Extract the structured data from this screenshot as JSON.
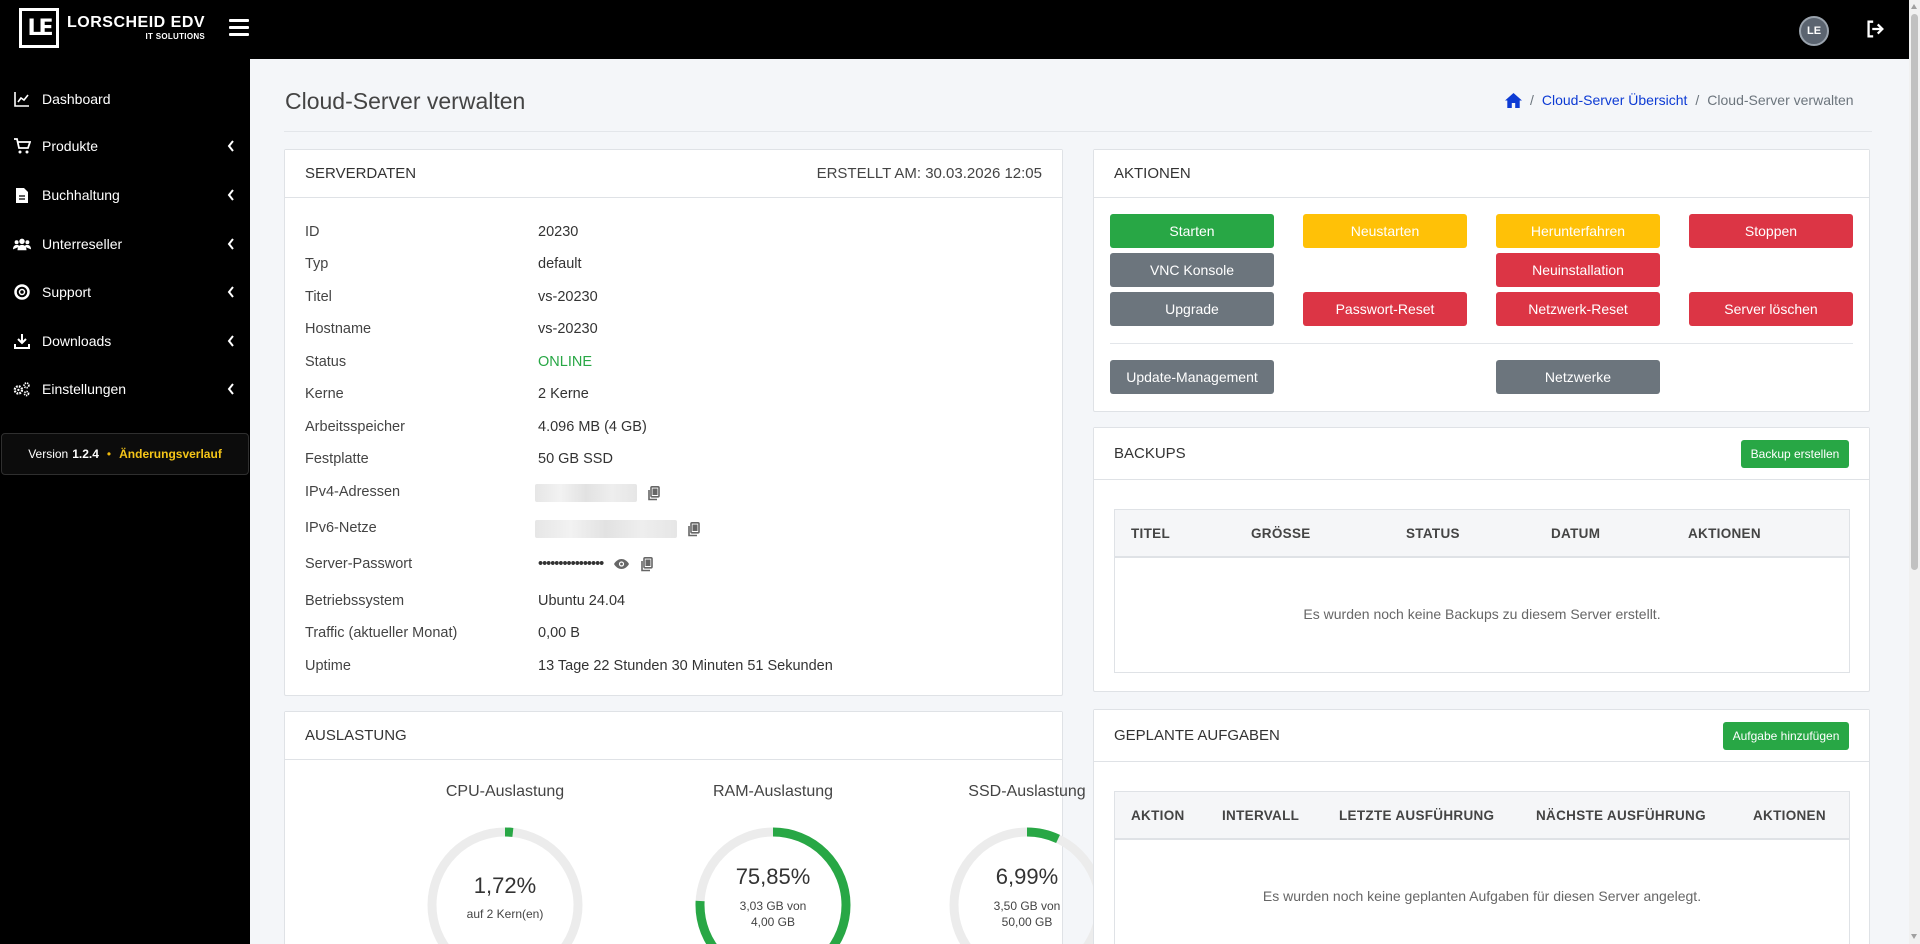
{
  "brand": {
    "name": "LORSCHEID EDV",
    "tagline": "IT SOLUTIONS",
    "mark": "LE"
  },
  "user": {
    "avatar_initials": "LE"
  },
  "sidebar": {
    "items": [
      {
        "label": "Dashboard",
        "icon": "chart-line-icon"
      },
      {
        "label": "Produkte",
        "icon": "cart-icon"
      },
      {
        "label": "Buchhaltung",
        "icon": "invoice-icon"
      },
      {
        "label": "Unterreseller",
        "icon": "users-icon"
      },
      {
        "label": "Support",
        "icon": "lifebuoy-icon"
      },
      {
        "label": "Downloads",
        "icon": "download-icon"
      },
      {
        "label": "Einstellungen",
        "icon": "cogs-icon"
      }
    ],
    "version_label": "Version",
    "version_number": "1.2.4",
    "version_separator": "•",
    "changelog_label": "Änderungsverlauf"
  },
  "page": {
    "title": "Cloud-Server verwalten"
  },
  "breadcrumb": {
    "link": "Cloud-Server Übersicht",
    "separator": "/",
    "current": "Cloud-Server verwalten"
  },
  "serverdata": {
    "title": "SERVERDATEN",
    "created": "ERSTELLT AM: 30.03.2026 12:05",
    "rows": [
      {
        "label": "ID",
        "value": "20230"
      },
      {
        "label": "Typ",
        "value": "default"
      },
      {
        "label": "Titel",
        "value": "vs-20230"
      },
      {
        "label": "Hostname",
        "value": "vs-20230"
      },
      {
        "label": "Status",
        "value": "ONLINE"
      },
      {
        "label": "Kerne",
        "value": "2 Kerne"
      },
      {
        "label": "Arbeitsspeicher",
        "value": "4.096 MB (4 GB)"
      },
      {
        "label": "Festplatte",
        "value": "50 GB SSD"
      },
      {
        "label": "IPv4-Adressen",
        "value": ""
      },
      {
        "label": "IPv6-Netze",
        "value": ""
      },
      {
        "label": "Server-Passwort",
        "value": "••••••••••••••••"
      },
      {
        "label": "Betriebssystem",
        "value": "Ubuntu 24.04"
      },
      {
        "label": "Traffic (aktueller Monat)",
        "value": "0,00 B"
      },
      {
        "label": "Uptime",
        "value": "13 Tage 22 Stunden 30 Minuten 51 Sekunden"
      }
    ]
  },
  "actions": {
    "title": "AKTIONEN",
    "start": "Starten",
    "restart": "Neustarten",
    "shutdown": "Herunterfahren",
    "stop": "Stoppen",
    "vnc": "VNC Konsole",
    "reinstall": "Neuinstallation",
    "upgrade": "Upgrade",
    "password_reset": "Passwort-Reset",
    "network_reset": "Netzwerk-Reset",
    "delete": "Server löschen",
    "update_mgmt": "Update-Management",
    "networks": "Netzwerke"
  },
  "backups": {
    "title": "BACKUPS",
    "create_button": "Backup erstellen",
    "columns": [
      "TITEL",
      "GRÖSSE",
      "STATUS",
      "DATUM",
      "AKTIONEN"
    ],
    "empty": "Es wurden noch keine Backups zu diesem Server erstellt."
  },
  "tasks": {
    "title": "GEPLANTE AUFGABEN",
    "add_button": "Aufgabe hinzufügen",
    "columns": [
      "AKTION",
      "INTERVALL",
      "LETZTE AUSFÜHRUNG",
      "NÄCHSTE AUSFÜHRUNG",
      "AKTIONEN"
    ],
    "empty": "Es wurden noch keine geplanten Aufgaben für diesen Server angelegt."
  },
  "usage": {
    "title": "AUSLASTUNG",
    "cpu": {
      "title": "CPU-Auslastung",
      "percent": 1.72,
      "label": "1,72%",
      "sub": "auf 2 Kern(en)"
    },
    "ram": {
      "title": "RAM-Auslastung",
      "percent": 75.85,
      "label": "75,85%",
      "sub1": "3,03 GB von",
      "sub2": "4,00 GB"
    },
    "ssd": {
      "title": "SSD-Auslastung",
      "percent": 6.99,
      "label": "6,99%",
      "sub1": "3,50 GB von",
      "sub2": "50,00 GB"
    }
  },
  "colors": {
    "accent_green": "#28a745",
    "warning": "#ffc107",
    "danger": "#dc3545",
    "secondary": "#6c757d",
    "link": "#0d3bd4",
    "gauge_track": "#ececec"
  }
}
